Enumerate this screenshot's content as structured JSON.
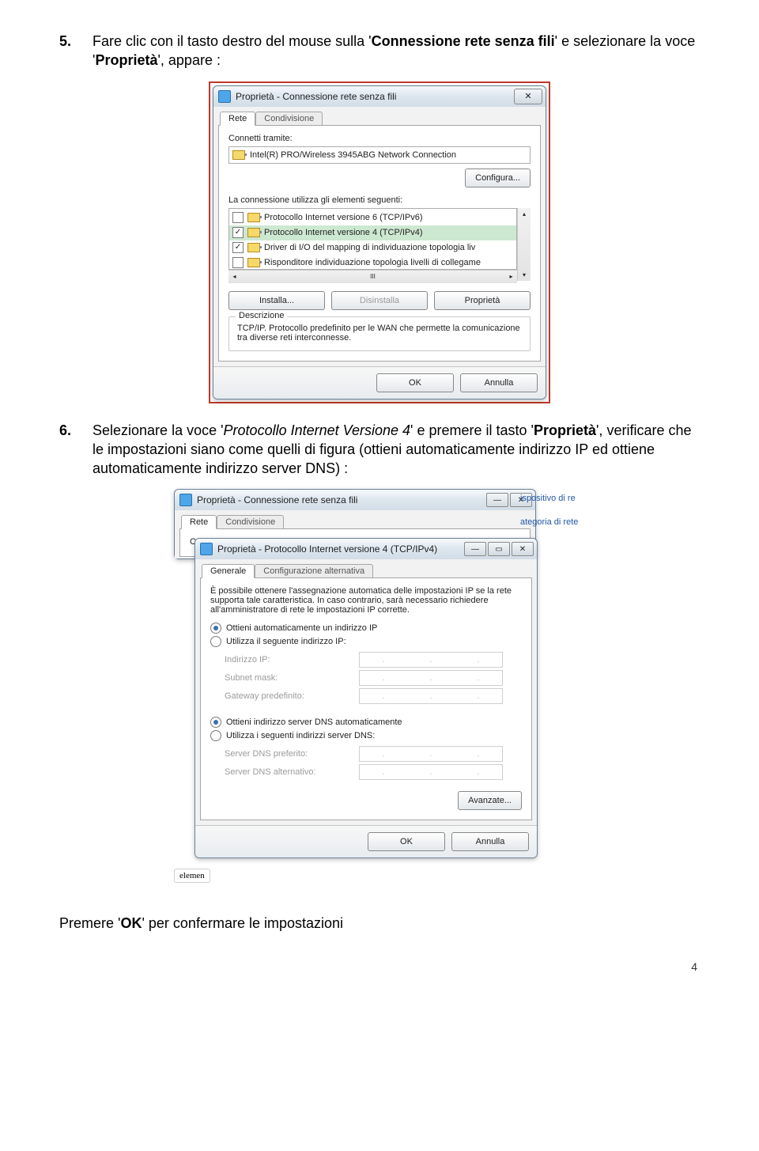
{
  "page": {
    "number": "4"
  },
  "step5": {
    "num": "5.",
    "t1a": "Fare clic con il tasto destro del mouse sulla '",
    "t1b": "Connessione rete senza fili",
    "t1c": "' e selezionare la voce '",
    "t1d": "Proprietà",
    "t1e": "', appare :"
  },
  "step6": {
    "num": "6.",
    "t2a": "Selezionare la voce '",
    "t2b": "Protocollo Internet Versione 4",
    "t2c": "' e premere il tasto '",
    "t2d": "Proprietà",
    "t2e": "', verificare che le impostazioni siano come quelli di figura (ottieni automaticamente indirizzo IP ed ottiene automaticamente indirizzo server DNS) :"
  },
  "dlg1": {
    "title": "Proprietà - Connessione rete senza fili",
    "close": "✕",
    "tabs": {
      "rete": "Rete",
      "cond": "Condivisione"
    },
    "connetti": "Connetti tramite:",
    "adapter": "Intel(R) PRO/Wireless 3945ABG Network Connection",
    "configura": "Configura...",
    "elements_lbl": "La connessione utilizza gli elementi seguenti:",
    "items": {
      "ipv6": "Protocollo Internet versione 6 (TCP/IPv6)",
      "ipv4": "Protocollo Internet versione 4 (TCP/IPv4)",
      "lldio": "Driver di I/O del mapping di individuazione topologia liv",
      "lldr": "Risponditore individuazione topologia livelli di collegame"
    },
    "checks": {
      "ipv6": false,
      "ipv4": true,
      "lldio": true,
      "lldr": false
    },
    "installa": "Installa...",
    "disinstalla": "Disinstalla",
    "proprieta": "Proprietà",
    "descr_title": "Descrizione",
    "descr_text": "TCP/IP. Protocollo predefinito per le WAN che permette la comunicazione tra diverse reti interconnesse.",
    "ok": "OK",
    "annulla": "Annulla",
    "scrollmark": "III"
  },
  "dlg2": {
    "behind_title": "Proprietà - Connessione rete senza fili",
    "tabs": {
      "rete": "Rete",
      "cond": "Condivisione"
    },
    "c_short": "C",
    "title": "Proprietà - Protocollo Internet versione 4 (TCP/IPv4)",
    "tabs2": {
      "gen": "Generale",
      "alt": "Configurazione alternativa"
    },
    "intro": "È possibile ottenere l'assegnazione automatica delle impostazioni IP se la rete supporta tale caratteristica. In caso contrario, sarà necessario richiedere all'amministratore di rete le impostazioni IP corrette.",
    "r_autoip": "Ottieni automaticamente un indirizzo IP",
    "r_manualip": "Utilizza il seguente indirizzo IP:",
    "ip": "Indirizzo IP:",
    "mask": "Subnet mask:",
    "gw": "Gateway predefinito:",
    "r_autodns": "Ottieni indirizzo server DNS automaticamente",
    "r_manualdns": "Utilizza i seguenti indirizzi server DNS:",
    "dns1": "Server DNS preferito:",
    "dns2": "Server DNS alternativo:",
    "avanzate": "Avanzate...",
    "ok": "OK",
    "annulla": "Annulla",
    "elem": "elemen",
    "side1": "ispositivo di re",
    "side2": "ategoria di rete",
    "min": "—",
    "max": "▭",
    "close": "✕"
  },
  "bottom": {
    "t3a": "Premere '",
    "t3b": "OK",
    "t3c": "' per confermare le impostazioni"
  }
}
